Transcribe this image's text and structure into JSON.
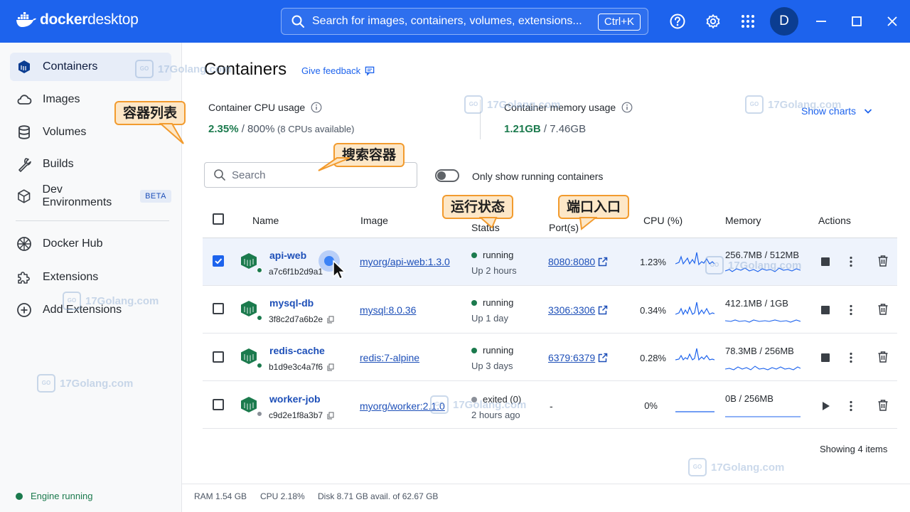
{
  "app": {
    "brand_bold": "docker",
    "brand_light": "desktop",
    "search_placeholder": "Search for images, containers, volumes, extensions...",
    "search_shortcut": "Ctrl+K",
    "avatar_initial": "D",
    "accent_color": "#1d63ed"
  },
  "sidebar": {
    "items": [
      {
        "label": "Containers",
        "icon": "containers-icon"
      },
      {
        "label": "Images",
        "icon": "cloud-icon"
      },
      {
        "label": "Volumes",
        "icon": "database-icon"
      },
      {
        "label": "Builds",
        "icon": "wrench-icon"
      },
      {
        "label": "Dev Environments",
        "icon": "cube-icon",
        "badge": "BETA"
      },
      {
        "label": "Docker Hub",
        "icon": "hub-icon"
      },
      {
        "label": "Extensions",
        "icon": "puzzle-icon"
      },
      {
        "label": "Add Extensions",
        "icon": "plus-circle-icon"
      }
    ],
    "engine_status": "Engine running"
  },
  "main": {
    "title": "Containers",
    "feedback": "Give feedback",
    "cpu_label": "Container CPU usage",
    "cpu_value": "2.35%",
    "cpu_total": " / 800%",
    "cpu_note": " (8 CPUs available)",
    "mem_label": "Container memory usage",
    "mem_value": "1.21GB",
    "mem_total": " / 7.46GB",
    "show_charts": "Show charts",
    "search_placeholder": "Search",
    "toggle_label": "Only show running containers",
    "columns": [
      "Name",
      "Image",
      "Status",
      "Port(s)",
      "CPU (%)",
      "Memory",
      "Actions"
    ],
    "rows": [
      {
        "name": "api-web",
        "id": "a7c6f1b2d9a1",
        "image": "myorg/api-web:1.3.0",
        "status": "running",
        "uptime": "Up 2 hours",
        "port": "8080:8080",
        "cpu": "1.23%",
        "memory": "256.7MB / 512MB",
        "state_color": "#1b7a4d"
      },
      {
        "name": "mysql-db",
        "id": "3f8c2d7a6b2e",
        "image": "mysql:8.0.36",
        "status": "running",
        "uptime": "Up 1 day",
        "port": "3306:3306",
        "cpu": "0.34%",
        "memory": "412.1MB / 1GB",
        "state_color": "#1b7a4d"
      },
      {
        "name": "redis-cache",
        "id": "b1d9e3c4a7f6",
        "image": "redis:7-alpine",
        "status": "running",
        "uptime": "Up 3 days",
        "port": "6379:6379",
        "cpu": "0.28%",
        "memory": "78.3MB / 256MB",
        "state_color": "#1b7a4d"
      },
      {
        "name": "worker-job",
        "id": "c9d2e1f8a3b7",
        "image": "myorg/worker:2.1.0",
        "status": "exited (0)",
        "uptime": "2 hours ago",
        "port": "-",
        "cpu": "0%",
        "memory": "0B / 256MB",
        "state_color": "#8b9099"
      }
    ],
    "showing": "Showing 4 items"
  },
  "footer": {
    "ram": "RAM 1.54 GB",
    "cpu": "CPU 2.18%",
    "disk": "Disk 8.71 GB avail. of 62.67 GB"
  },
  "annotations": {
    "container_list": "容器列表",
    "search_containers": "搜索容器",
    "run_status": "运行状态",
    "port_entry": "端口入口"
  },
  "watermark": "17Golang.com"
}
